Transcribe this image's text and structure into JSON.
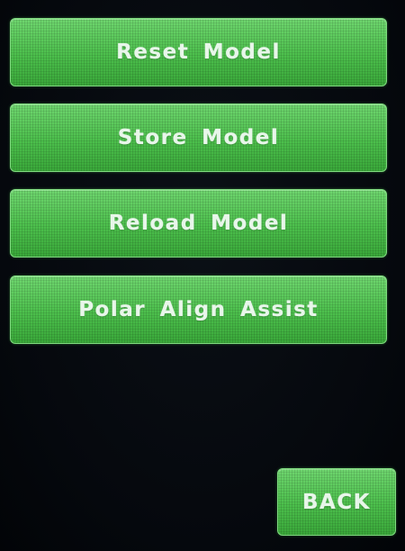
{
  "menu": {
    "buttons": [
      {
        "label": "Reset Model"
      },
      {
        "label": "Store Model"
      },
      {
        "label": "Reload Model"
      },
      {
        "label": "Polar Align Assist"
      }
    ]
  },
  "footer": {
    "back_label": "BACK"
  },
  "colors": {
    "background": "#05080d",
    "button_green": "#4cbf4c",
    "button_text": "#e8f6ea"
  }
}
